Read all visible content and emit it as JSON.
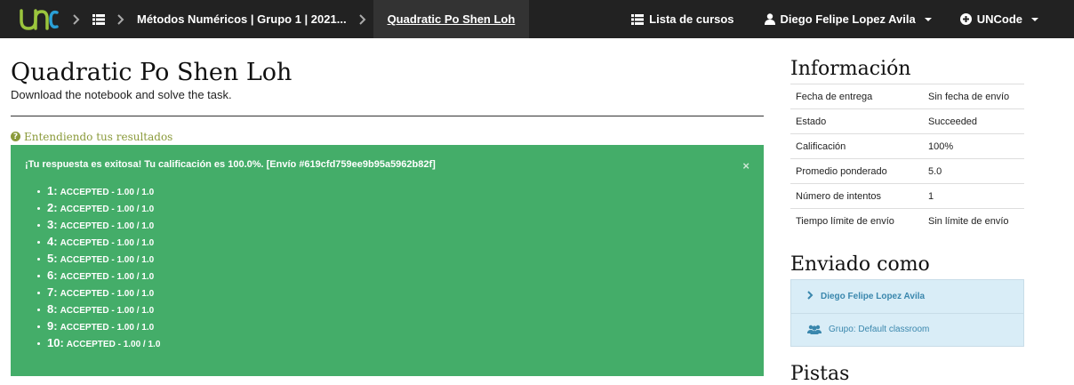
{
  "navbar": {
    "logo_text": "UNC",
    "crumbs": [
      "Métodos Numéricos | Grupo 1 | 2021...",
      "Quadratic Po Shen Loh"
    ],
    "course_list": "Lista de cursos",
    "user": "Diego Felipe Lopez Avila",
    "brand_menu": "UNCode",
    "colors": {
      "bg": "#222222",
      "logo_green": "#9bc53d",
      "logo_blue": "#2a9fd6"
    }
  },
  "task": {
    "title": "Quadratic Po Shen Loh",
    "description": "Download the notebook and solve the task.",
    "understanding_link": "Entendiendo tus resultados"
  },
  "alert": {
    "message": "¡Tu respuesta es exitosa! Tu calificación es 100.0%. [Envío #619cfd759ee9b95a5962b82f]",
    "close": "×",
    "results": [
      {
        "n": "1:",
        "status": "ACCEPTED - 1.00 / 1.0"
      },
      {
        "n": "2:",
        "status": "ACCEPTED - 1.00 / 1.0"
      },
      {
        "n": "3:",
        "status": "ACCEPTED - 1.00 / 1.0"
      },
      {
        "n": "4:",
        "status": "ACCEPTED - 1.00 / 1.0"
      },
      {
        "n": "5:",
        "status": "ACCEPTED - 1.00 / 1.0"
      },
      {
        "n": "6:",
        "status": "ACCEPTED - 1.00 / 1.0"
      },
      {
        "n": "7:",
        "status": "ACCEPTED - 1.00 / 1.0"
      },
      {
        "n": "8:",
        "status": "ACCEPTED - 1.00 / 1.0"
      },
      {
        "n": "9:",
        "status": "ACCEPTED - 1.00 / 1.0"
      },
      {
        "n": "10:",
        "status": "ACCEPTED - 1.00 / 1.0"
      }
    ],
    "color": "#44ad69"
  },
  "info": {
    "title": "Información",
    "rows": [
      {
        "label": "Fecha de entrega",
        "value": "Sin fecha de envío"
      },
      {
        "label": "Estado",
        "value": "Succeeded"
      },
      {
        "label": "Calificación",
        "value": "100%"
      },
      {
        "label": "Promedio ponderado",
        "value": "5.0"
      },
      {
        "label": "Número de intentos",
        "value": "1"
      },
      {
        "label": "Tiempo límite de envío",
        "value": "Sin límite de envío"
      }
    ]
  },
  "sent_as": {
    "title": "Enviado como",
    "user": "Diego Felipe Lopez Avila",
    "group": "Grupo: Default classroom"
  },
  "next_section_title": "Pistas"
}
